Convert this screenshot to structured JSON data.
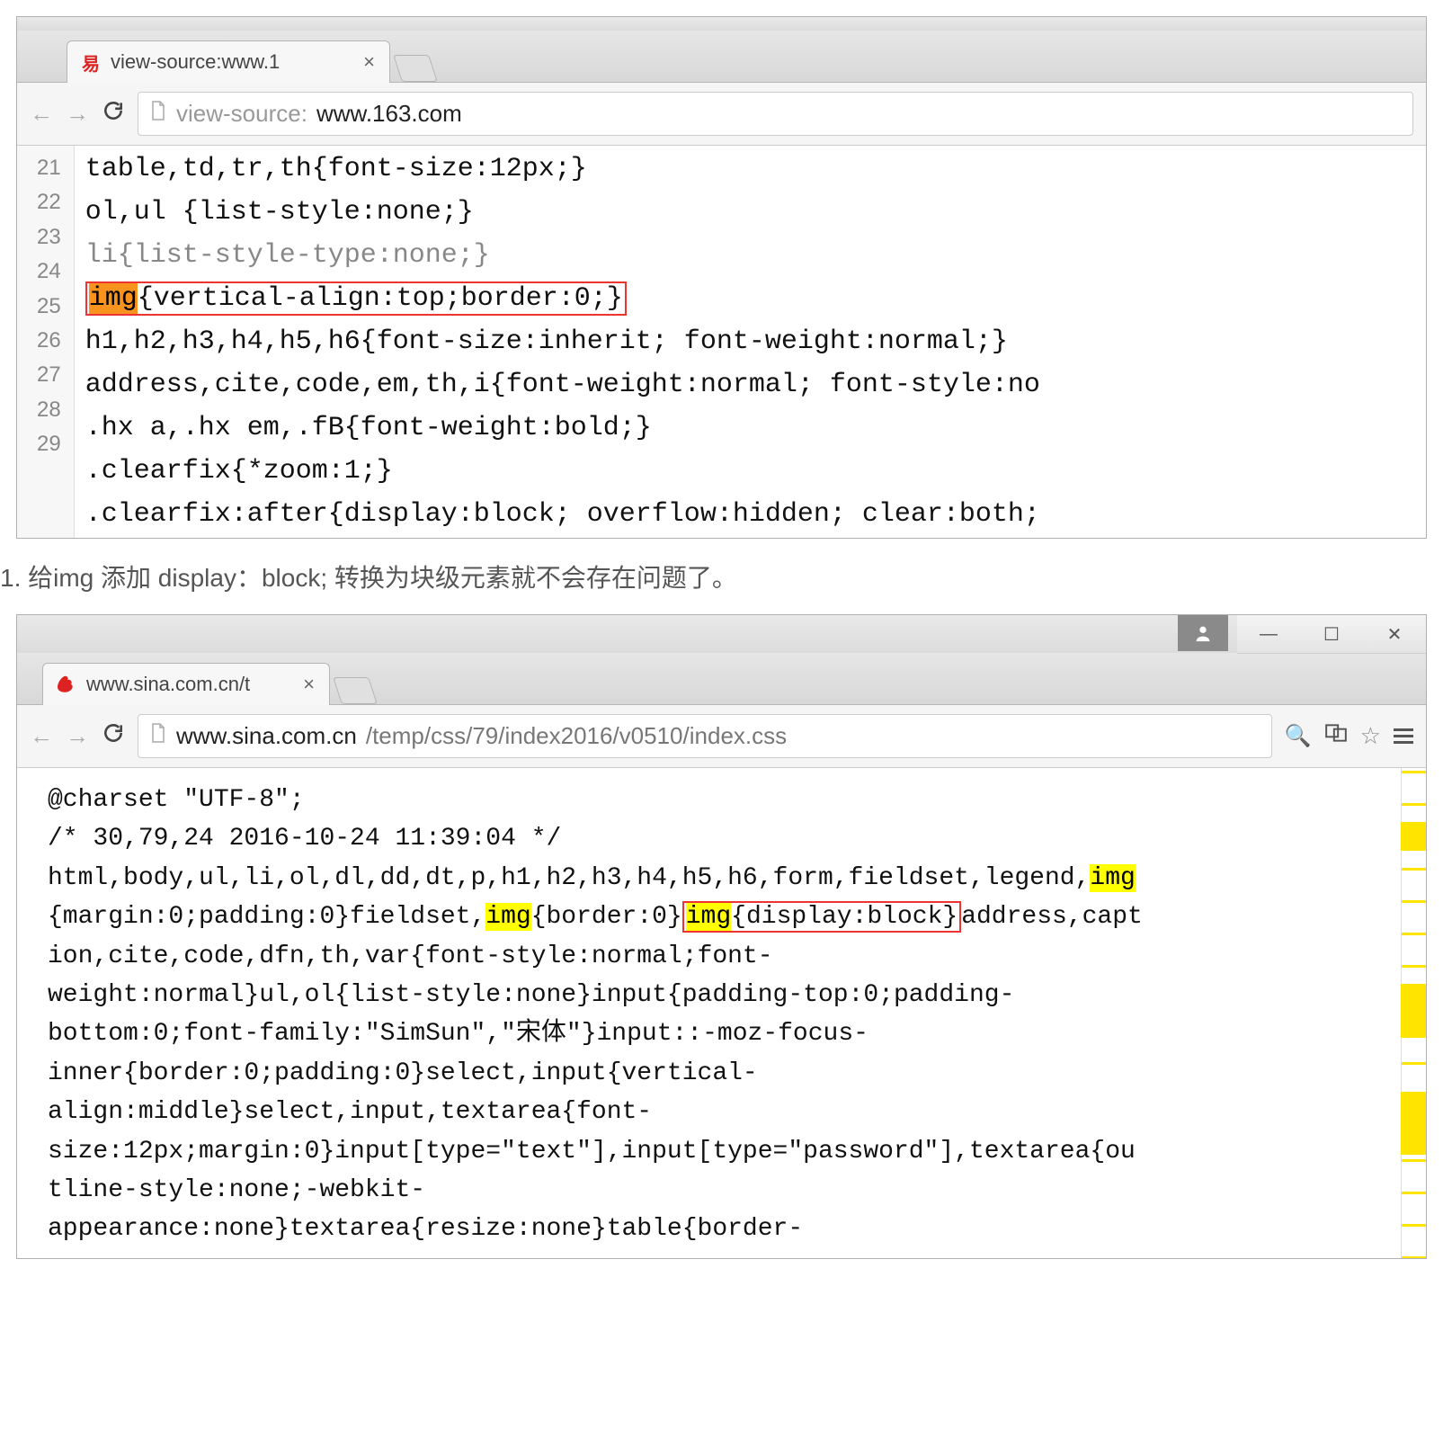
{
  "w1": {
    "tab_title": "view-source:www.1",
    "favicon": "易",
    "proto": "view-source:",
    "host": "www.163.com",
    "path": "",
    "gutter": "21\n22\n23\n24\n25\n26\n27\n28\n29",
    "lines": {
      "l21": "table,td,tr,th{font-size:12px;}",
      "l22": "ol,ul {list-style:none;}",
      "l23": "li{list-style-type:none;}",
      "l24a": "img",
      "l24b": "{vertical-align:top;border:0;}",
      "l25": "h1,h2,h3,h4,h5,h6{font-size:inherit; font-weight:normal;}",
      "l26": "address,cite,code,em,th,i{font-weight:normal; font-style:no",
      "l27": ".hx a,.hx em,.fB{font-weight:bold;}",
      "l28": ".clearfix{*zoom:1;}",
      "l29": ".clearfix:after{display:block; overflow:hidden; clear:both;"
    }
  },
  "caption": "1. 给img 添加 display：block; 转换为块级元素就不会存在问题了。",
  "w2": {
    "tab_title": "www.sina.com.cn/t",
    "proto": "",
    "host": "www.sina.com.cn",
    "path": "/temp/css/79/index2016/v0510/index.css",
    "code": {
      "l1": "@charset \"UTF-8\";",
      "l2": "/* 30,79,24 2016-10-24 11:39:04 */",
      "l3a": "html,body,ul,li,ol,dl,dd,dt,p,h1,h2,h3,h4,h5,h6,form,fieldset,legend,",
      "l3b": "img",
      "l4a": "{margin:0;padding:0}fieldset,",
      "l4b": "img",
      "l4c": "{border:0}",
      "l4d": "img",
      "l4e": "{display:block}",
      "l4f": "address,capt",
      "l5": "ion,cite,code,dfn,th,var{font-style:normal;font-",
      "l6": "weight:normal}ul,ol{list-style:none}input{padding-top:0;padding-",
      "l7": "bottom:0;font-family:\"SimSun\",\"宋体\"}input::-moz-focus-",
      "l8": "inner{border:0;padding:0}select,input{vertical-",
      "l9": "align:middle}select,input,textarea{font-",
      "l10": "size:12px;margin:0}input[type=\"text\"],input[type=\"password\"],textarea{ou",
      "l11": "tline-style:none;-webkit-",
      "l12": "appearance:none}textarea{resize:none}table{border-"
    }
  }
}
